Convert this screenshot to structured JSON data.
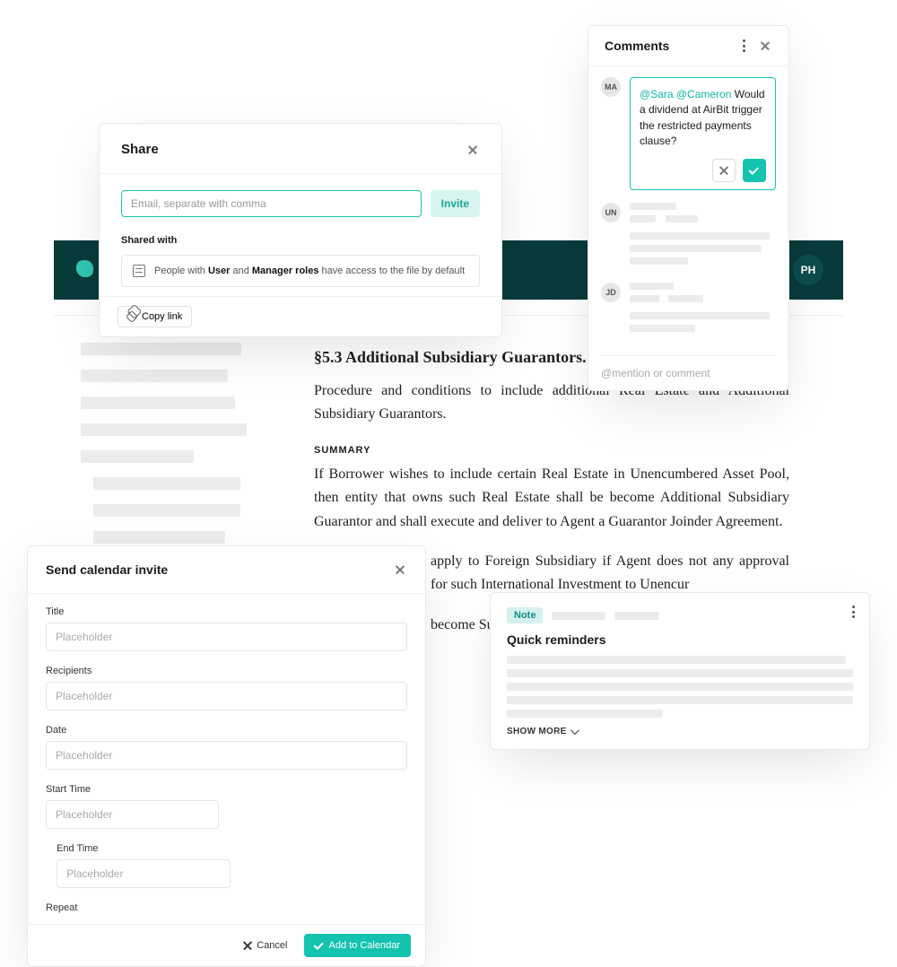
{
  "header": {
    "avatar": "PH"
  },
  "share": {
    "title": "Share",
    "email_placeholder": "Email, separate with comma",
    "invite_label": "Invite",
    "shared_with_label": "Shared with",
    "perm_prefix": "People with ",
    "perm_role1": "User",
    "perm_mid": " and ",
    "perm_role2": "Manager roles",
    "perm_suffix": " have access to the file by default",
    "copy_link_label": "Copy link"
  },
  "comments": {
    "title": "Comments",
    "items": [
      {
        "avatar": "MA",
        "mentions": "@Sara @Cameron",
        "text": " Would a dividend at AirBit trigger the restricted payments clause?"
      },
      {
        "avatar": "UN"
      },
      {
        "avatar": "JD"
      }
    ],
    "input_placeholder": "@mention or comment"
  },
  "doc": {
    "heading": "§5.3 Additional Subsidiary Guarantors.",
    "lead": "Procedure and conditions to include additional Real Estate and Additional Subsidiary Guarantors.",
    "summary_label": "SUMMARY",
    "p1": "If Borrower wishes to include certain Real Estate in Unencumbered Asset Pool, then entity that owns such Real Estate shall be become Additional Subsidiary Guarantor and shall execute and deliver to Agent a Guarantor Joinder Agreement.",
    "p2": "apply to Foreign Subsidiary if Agent does not any approval for such International Investment to Unencur",
    "p3": "become Subsidiary to"
  },
  "calendar": {
    "title": "Send calendar invite",
    "fields": {
      "title_label": "Title",
      "recipients_label": "Recipients",
      "date_label": "Date",
      "start_label": "Start Time",
      "end_label": "End Time",
      "repeat_label": "Repeat",
      "placeholder": "Placeholder"
    },
    "cancel_label": "Cancel",
    "submit_label": "Add to Calendar"
  },
  "note": {
    "tag": "Note",
    "title": "Quick reminders",
    "show_more": "SHOW MORE"
  }
}
